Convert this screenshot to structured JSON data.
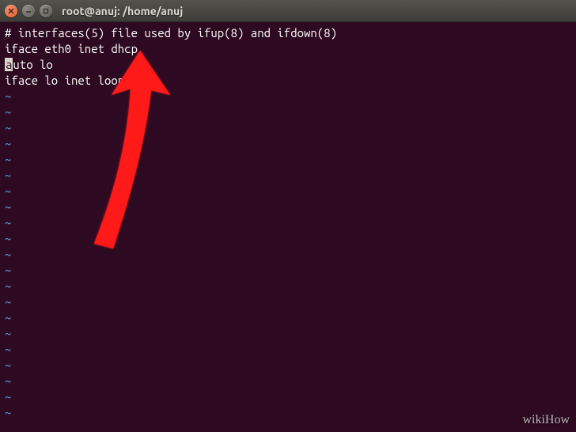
{
  "window": {
    "title": "root@anuj: /home/anuj"
  },
  "editor": {
    "lines": [
      "# interfaces(5) file used by ifup(8) and ifdown(8)",
      "iface eth0 inet dhcp",
      "auto lo",
      "iface lo inet loopback"
    ],
    "cursor": {
      "line": 2,
      "col": 0
    },
    "tilde": "~",
    "empty_rows": 21
  },
  "overlay": {
    "arrow_color": "#ff1a1a"
  },
  "watermark": "wikiHow"
}
